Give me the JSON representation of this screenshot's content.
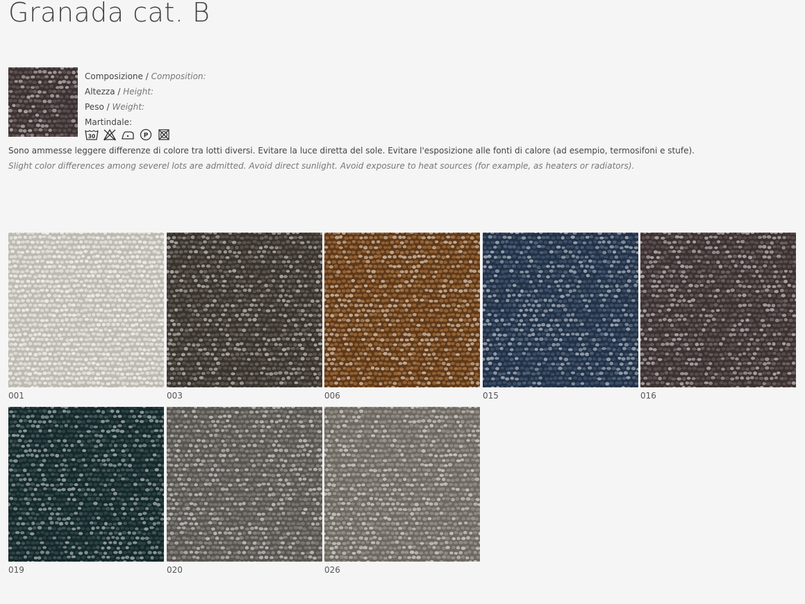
{
  "page": {
    "title": "Granada cat. B"
  },
  "specs": {
    "composition": {
      "it": "Composizione",
      "sep": " / ",
      "en": "Composition",
      "colon": ":"
    },
    "height": {
      "it": "Altezza",
      "sep": " / ",
      "en": "Height",
      "colon": ":"
    },
    "weight": {
      "it": "Peso",
      "sep": " / ",
      "en": "Weight",
      "colon": ":"
    },
    "martindale": {
      "label": "Martindale:"
    }
  },
  "care_icons": [
    "wash-30-icon",
    "no-bleach-icon",
    "iron-low-icon",
    "dry-clean-p-icon",
    "no-tumble-dry-icon"
  ],
  "care_labels": {
    "wash": "30",
    "dryclean": "P"
  },
  "notes": {
    "it": "Sono ammesse leggere differenze di colore tra lotti diversi. Evitare la luce diretta del sole. Evitare l'esposizione alle fonti di calore (ad esempio, termosifoni e stufe).",
    "en": "Slight color differences among severel lots are admitted. Avoid direct sunlight. Avoid exposure to heat sources (for example, as heaters or radiators)."
  },
  "swatches": [
    {
      "code": "001",
      "color": "#e2e0d9",
      "shade": "#bdbab1"
    },
    {
      "code": "003",
      "color": "#5d564d",
      "shade": "#3a342e"
    },
    {
      "code": "006",
      "color": "#9a6635",
      "shade": "#5e3a1c"
    },
    {
      "code": "015",
      "color": "#3e5169",
      "shade": "#233246"
    },
    {
      "code": "016",
      "color": "#5e5050",
      "shade": "#3d3232"
    },
    {
      "code": "019",
      "color": "#2c4648",
      "shade": "#162829"
    },
    {
      "code": "020",
      "color": "#7d7a76",
      "shade": "#58554f"
    },
    {
      "code": "026",
      "color": "#938d85",
      "shade": "#6e6860"
    }
  ],
  "thumbnail": {
    "color": "#5e5050",
    "shade": "#3d3232"
  }
}
